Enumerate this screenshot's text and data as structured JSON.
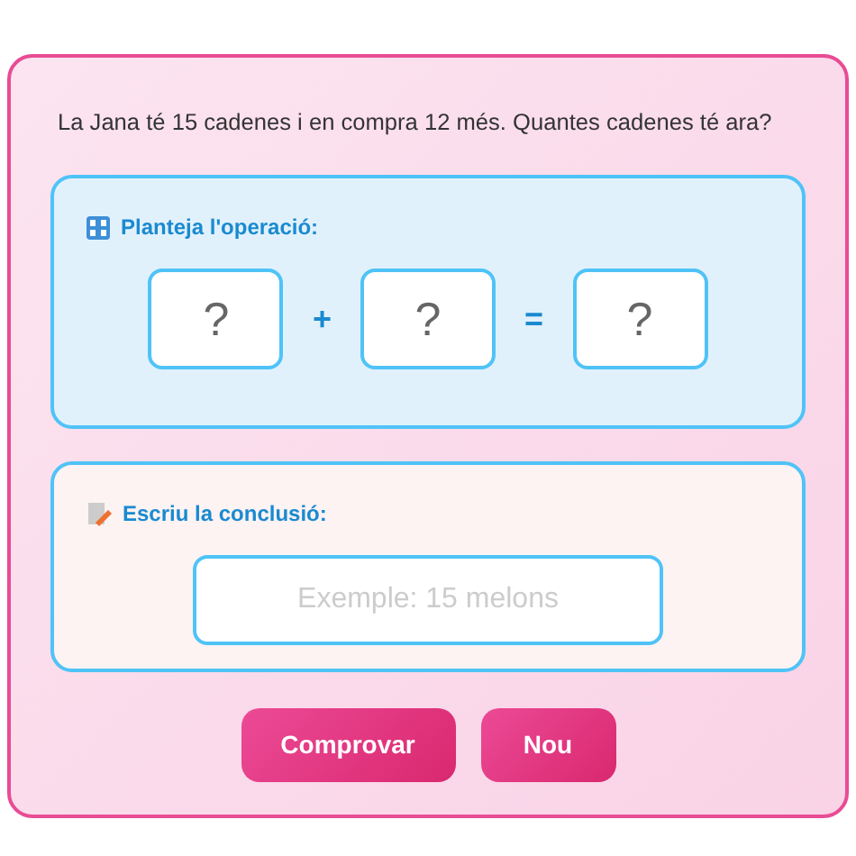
{
  "question": "La Jana té 15 cadenes i en compra 12 més. Quantes cadenes té ara?",
  "operation": {
    "title": "Planteja l'operació:",
    "slots": [
      {
        "kind": "field",
        "placeholder": "?"
      },
      {
        "kind": "operator",
        "text": "+"
      },
      {
        "kind": "field",
        "placeholder": "?"
      },
      {
        "kind": "operator",
        "text": "="
      },
      {
        "kind": "field",
        "placeholder": "?"
      }
    ]
  },
  "conclusion": {
    "title": "Escriu la conclusió:",
    "placeholder": "Exemple: 15 melons"
  },
  "buttons": [
    "Comprovar",
    "Nou"
  ]
}
